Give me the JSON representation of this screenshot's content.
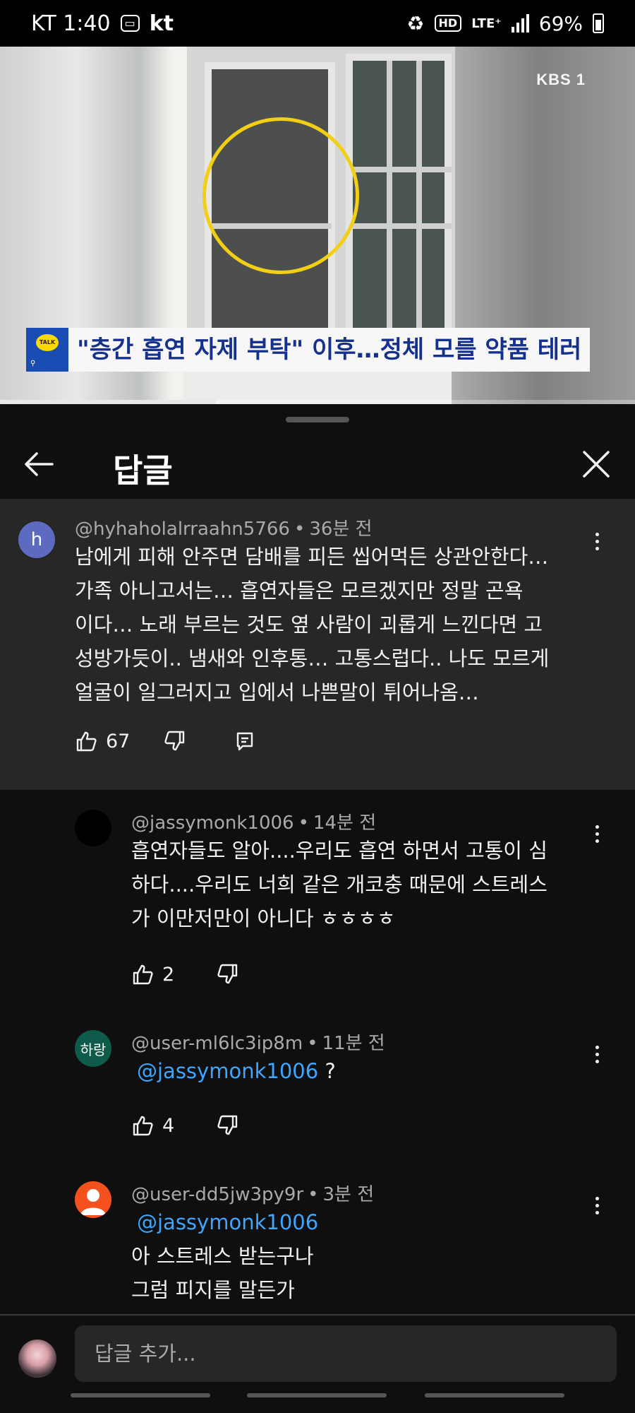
{
  "status_bar": {
    "carrier_time": "KT 1:40",
    "carrier2": "kt",
    "hd": "HD",
    "network": "LTE⁺",
    "battery": "69%"
  },
  "video": {
    "channel_logo": "KBS 1",
    "caption": "\"층간 흡연 자제 부탁\" 이후…정체 모를 약품 테러",
    "caption_logo_text": "TALK",
    "progress": 0.34
  },
  "sheet": {
    "title": "답글"
  },
  "main_comment": {
    "avatar_letter": "h",
    "avatar_color": "#5c6bc0",
    "author": "@hyhaholalrraahn5766",
    "time": "36분 전",
    "lines": [
      "남에게 피해 안주면 담배를 피든 씹어먹든 상관안한다…",
      "가족 아니고서는…  흡연자들은 모르겠지만 정말 곤욕",
      "이다… 노래 부르는 것도 옆 사람이 괴롭게 느낀다면 고",
      "성방가듯이.. 냄새와 인후통… 고통스럽다.. 나도 모르게",
      "얼굴이 일그러지고 입에서 나쁜말이 튀어나옴…"
    ],
    "likes": "67"
  },
  "replies": [
    {
      "avatar_text": "",
      "avatar_color": "#000000",
      "author": "@jassymonk1006",
      "time": "14분 전",
      "mention": "",
      "lines": [
        "흡연자들도 알아....우리도 흡연 하면서 고통이 심",
        "하다....우리도 너희 같은 개코충 때문에 스트레스",
        "가 이만저만이 아니다 ㅎㅎㅎㅎ"
      ],
      "likes": "2"
    },
    {
      "avatar_text": "하랑",
      "avatar_color": "#0f5b4a",
      "author": "@user-ml6lc3ip8m",
      "time": "11분 전",
      "mention": "@jassymonk1006",
      "mention_suffix": " ?",
      "lines": [],
      "likes": "4"
    },
    {
      "avatar_text": "",
      "avatar_color": "#f4511e",
      "author": "@user-dd5jw3py9r",
      "time": "3분 전",
      "mention": "@jassymonk1006",
      "mention_suffix": "",
      "lines": [
        "아 스트레스 받는구나",
        "그럼 피지를 말든가"
      ],
      "likes": ""
    }
  ],
  "reply_input": {
    "placeholder": "답글 추가..."
  }
}
